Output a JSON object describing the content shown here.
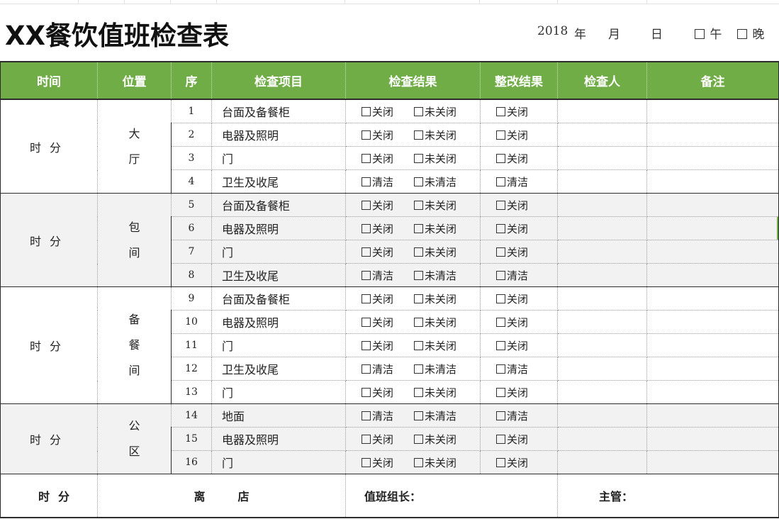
{
  "title": "XX餐饮值班检查表",
  "header": {
    "year": "2018",
    "year_unit": "年",
    "month_unit": "月",
    "day_unit": "日",
    "noon_label": "午",
    "evening_label": "晚"
  },
  "columns": [
    "时间",
    "位置",
    "序",
    "检查项目",
    "检查结果",
    "整改结果",
    "检查人",
    "备注"
  ],
  "time_text": {
    "hour": "时",
    "minute": "分"
  },
  "groups": [
    {
      "location": [
        "大",
        "厅"
      ],
      "rows": [
        {
          "seq": "1",
          "item": "台面及备餐柜",
          "opt1": "关闭",
          "opt2": "未关闭",
          "fix": "关闭"
        },
        {
          "seq": "2",
          "item": "电器及照明",
          "opt1": "关闭",
          "opt2": "未关闭",
          "fix": "关闭"
        },
        {
          "seq": "3",
          "item": "门",
          "opt1": "关闭",
          "opt2": "未关闭",
          "fix": "关闭"
        },
        {
          "seq": "4",
          "item": "卫生及收尾",
          "opt1": "清洁",
          "opt2": "未清洁",
          "fix": "清洁"
        }
      ]
    },
    {
      "location": [
        "包",
        "间"
      ],
      "rows": [
        {
          "seq": "5",
          "item": "台面及备餐柜",
          "opt1": "关闭",
          "opt2": "未关闭",
          "fix": "关闭"
        },
        {
          "seq": "6",
          "item": "电器及照明",
          "opt1": "关闭",
          "opt2": "未关闭",
          "fix": "关闭"
        },
        {
          "seq": "7",
          "item": "门",
          "opt1": "关闭",
          "opt2": "未关闭",
          "fix": "关闭"
        },
        {
          "seq": "8",
          "item": "卫生及收尾",
          "opt1": "清洁",
          "opt2": "未清洁",
          "fix": "清洁"
        }
      ]
    },
    {
      "location": [
        "备",
        "餐",
        "间"
      ],
      "rows": [
        {
          "seq": "9",
          "item": "台面及备餐柜",
          "opt1": "关闭",
          "opt2": "未关闭",
          "fix": "关闭"
        },
        {
          "seq": "10",
          "item": "电器及照明",
          "opt1": "关闭",
          "opt2": "未关闭",
          "fix": "关闭"
        },
        {
          "seq": "11",
          "item": "门",
          "opt1": "关闭",
          "opt2": "未关闭",
          "fix": "关闭"
        },
        {
          "seq": "12",
          "item": "卫生及收尾",
          "opt1": "清洁",
          "opt2": "未清洁",
          "fix": "清洁"
        },
        {
          "seq": "13",
          "item": "门",
          "opt1": "关闭",
          "opt2": "未关闭",
          "fix": "关闭"
        }
      ]
    },
    {
      "location": [
        "公",
        "区"
      ],
      "rows": [
        {
          "seq": "14",
          "item": "地面",
          "opt1": "清洁",
          "opt2": "未清洁",
          "fix": "清洁"
        },
        {
          "seq": "15",
          "item": "电器及照明",
          "opt1": "关闭",
          "opt2": "未关闭",
          "fix": "关闭"
        },
        {
          "seq": "16",
          "item": "门",
          "opt1": "关闭",
          "opt2": "未关闭",
          "fix": "关闭"
        }
      ]
    }
  ],
  "footer": {
    "leave_1": "离",
    "leave_2": "店",
    "team_leader": "值班组长：",
    "supervisor": "主管："
  }
}
